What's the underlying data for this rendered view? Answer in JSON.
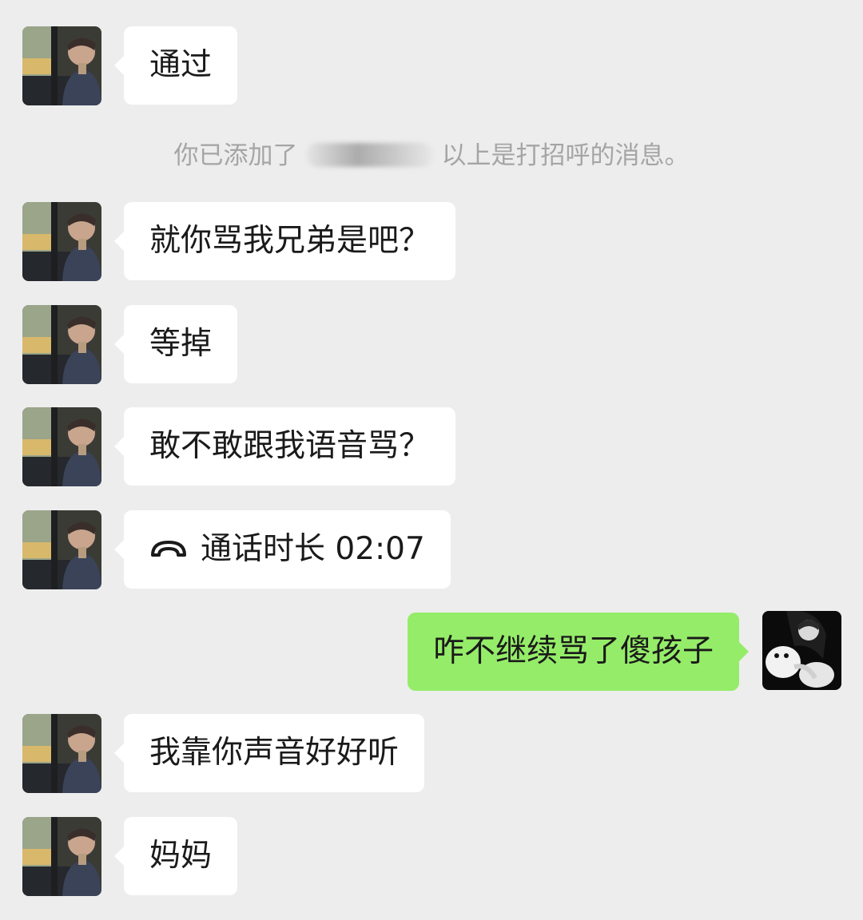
{
  "messages": [
    {
      "side": "in",
      "text": "通过"
    },
    {
      "side": "in",
      "text": "就你骂我兄弟是吧？"
    },
    {
      "side": "in",
      "text": "等掉"
    },
    {
      "side": "in",
      "text": "敢不敢跟我语音骂？"
    },
    {
      "side": "in",
      "type": "call",
      "icon": "phone-hangup-icon",
      "text": "通话时长 02:07"
    },
    {
      "side": "out",
      "text": "咋不继续骂了傻孩子"
    },
    {
      "side": "in",
      "text": "我靠你声音好好听"
    },
    {
      "side": "in",
      "text": "妈妈"
    }
  ],
  "system_notice": {
    "prefix": "你已添加了",
    "suffix": "以上是打招呼的消息。"
  },
  "colors": {
    "background": "#ededed",
    "incoming_bubble": "#ffffff",
    "outgoing_bubble": "#95ec69",
    "system_text": "#a5a5a5"
  }
}
